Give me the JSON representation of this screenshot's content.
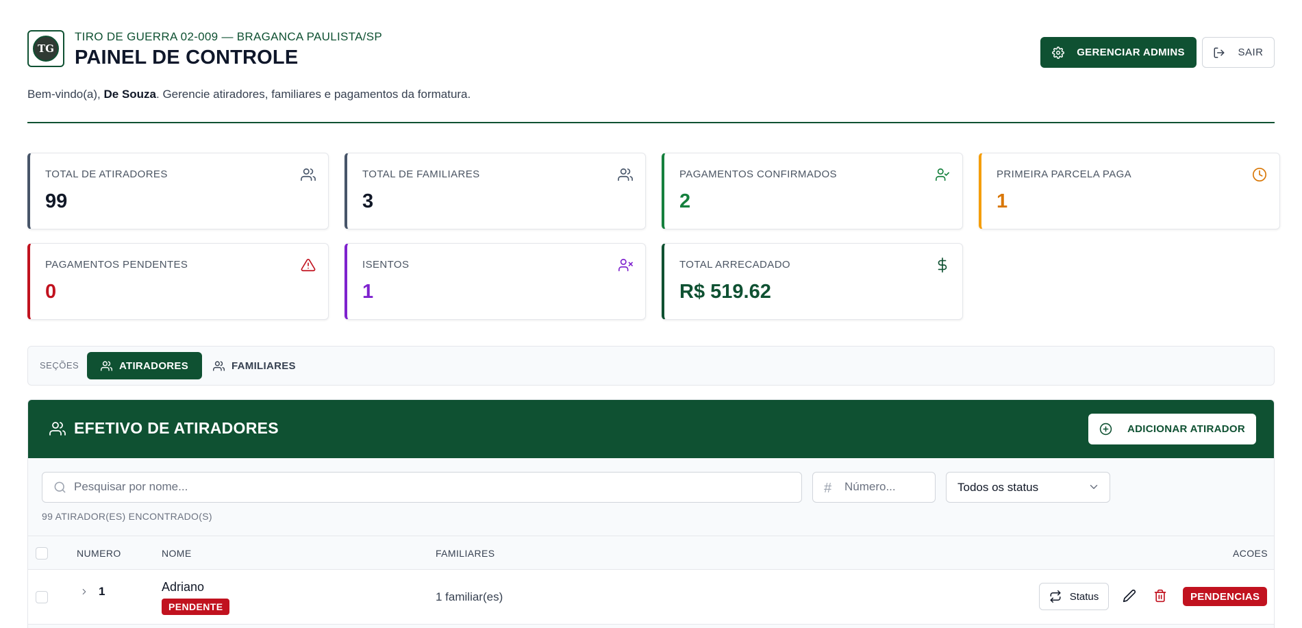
{
  "header": {
    "logo_text": "TG",
    "subtitle": "TIRO DE GUERRA 02-009 — BRAGANCA PAULISTA/SP",
    "title": "PAINEL DE CONTROLE",
    "admins_button": "GERENCIAR ADMINS",
    "logout_button": "SAIR"
  },
  "welcome": {
    "prefix": "Bem-vindo(a), ",
    "user": "De Souza",
    "suffix": ". Gerencie atiradores, familiares e pagamentos da formatura."
  },
  "stats": [
    {
      "label": "TOTAL DE ATIRADORES",
      "value": "99",
      "color": "#111827",
      "accent": "#475569",
      "icon": "users-icon"
    },
    {
      "label": "TOTAL DE FAMILIARES",
      "value": "3",
      "color": "#111827",
      "accent": "#475569",
      "icon": "users-icon"
    },
    {
      "label": "PAGAMENTOS CONFIRMADOS",
      "value": "2",
      "color": "#15803d",
      "accent": "#15803d",
      "icon": "user-check-icon"
    },
    {
      "label": "PRIMEIRA PARCELA PAGA",
      "value": "1",
      "color": "#d97706",
      "accent": "#f59e0b",
      "icon": "clock-icon"
    },
    {
      "label": "PAGAMENTOS PENDENTES",
      "value": "0",
      "color": "#c1121f",
      "accent": "#c1121f",
      "icon": "alert-triangle-icon"
    },
    {
      "label": "ISENTOS",
      "value": "1",
      "color": "#7e22ce",
      "accent": "#7e22ce",
      "icon": "user-x-icon"
    },
    {
      "label": "TOTAL ARRECADADO",
      "value": "R$ 519.62",
      "color": "#0f5132",
      "accent": "#0f5132",
      "icon": "dollar-icon"
    }
  ],
  "sections": {
    "label": "SEÇÕES",
    "tabs": [
      "ATIRADORES",
      "FAMILIARES"
    ],
    "active": "ATIRADORES"
  },
  "panel": {
    "title": "EFETIVO DE ATIRADORES",
    "add_button": "ADICIONAR ATIRADOR",
    "search_placeholder": "Pesquisar por nome...",
    "number_placeholder": "Número...",
    "status_filter": "Todos os status",
    "found_text": "99 ATIRADOR(ES) ENCONTRADO(S)",
    "columns": {
      "numero": "NUMERO",
      "nome": "NOME",
      "familiares": "FAMILIARES",
      "acoes": "ACOES"
    },
    "rows": [
      {
        "numero": "1",
        "nome": "Adriano",
        "status": "PENDENTE",
        "familiares": "1 familiar(es)",
        "status_button": "Status",
        "pendencias": "PENDENCIAS"
      }
    ]
  },
  "colors": {
    "brand": "#0f5132",
    "danger": "#c1121f"
  }
}
